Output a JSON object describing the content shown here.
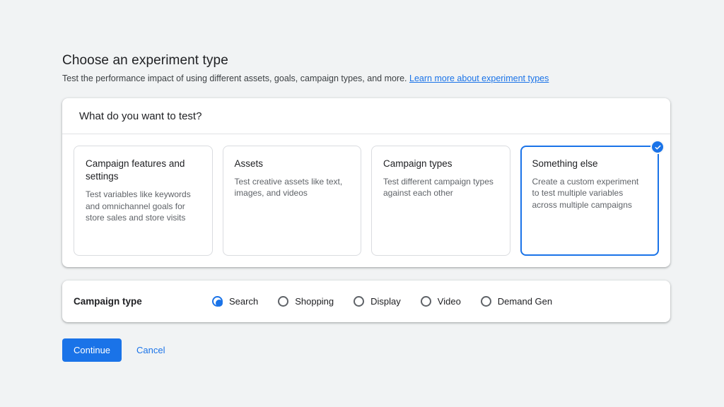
{
  "page": {
    "title": "Choose an experiment type",
    "subtitle": "Test the performance impact of using different assets, goals, campaign types, and more.",
    "learn_more_link": "Learn more about experiment types"
  },
  "test_card": {
    "question": "What do you want to test?",
    "options": [
      {
        "title": "Campaign features and settings",
        "description": "Test variables like keywords and omnichannel goals for store sales and store visits",
        "selected": false
      },
      {
        "title": "Assets",
        "description": "Test creative assets like text, images, and videos",
        "selected": false
      },
      {
        "title": "Campaign types",
        "description": "Test different campaign types against each other",
        "selected": false
      },
      {
        "title": "Something else",
        "description": "Create a custom experiment to test multiple variables across multiple campaigns",
        "selected": true
      }
    ]
  },
  "campaign_type": {
    "label": "Campaign type",
    "options": [
      {
        "label": "Search",
        "selected": true
      },
      {
        "label": "Shopping",
        "selected": false
      },
      {
        "label": "Display",
        "selected": false
      },
      {
        "label": "Video",
        "selected": false
      },
      {
        "label": "Demand Gen",
        "selected": false
      }
    ]
  },
  "actions": {
    "continue_label": "Continue",
    "cancel_label": "Cancel"
  },
  "icons": {
    "selected_check": "check-icon"
  },
  "colors": {
    "accent": "#1a73e8",
    "background": "#f1f3f4",
    "card_background": "#ffffff",
    "text_primary": "#202124",
    "text_secondary": "#5f6368",
    "border": "#dadce0"
  }
}
